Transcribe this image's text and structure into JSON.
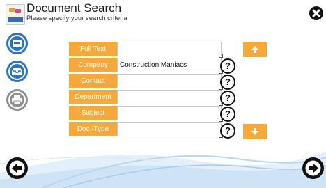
{
  "header": {
    "title": "Document Search",
    "subtitle": "Please specify your search criteria",
    "app_icon": "document-search-app-icon"
  },
  "form": {
    "fields": [
      {
        "label": "Full Text",
        "value": ""
      },
      {
        "label": "Company",
        "value": "Construction Maniacs"
      },
      {
        "label": "Contact",
        "value": ""
      },
      {
        "label": "Department",
        "value": ""
      },
      {
        "label": "Subject",
        "value": ""
      },
      {
        "label": "Doc.-Type",
        "value": ""
      }
    ],
    "help_glyph": "?"
  },
  "icons": {
    "close": "close-icon",
    "side": [
      "archive-tray-icon",
      "inbox-tray-icon",
      "printer-icon"
    ],
    "scroll_up": "arrow-up-icon",
    "scroll_down": "arrow-down-icon",
    "back": "arrow-left-icon",
    "forward": "arrow-right-icon"
  },
  "colors": {
    "accent_orange": "#f5a93a",
    "side_blue": "#2a73c0",
    "side_gray": "#8f8f8f",
    "dark": "#111111",
    "wave": "#b9d6f0"
  }
}
